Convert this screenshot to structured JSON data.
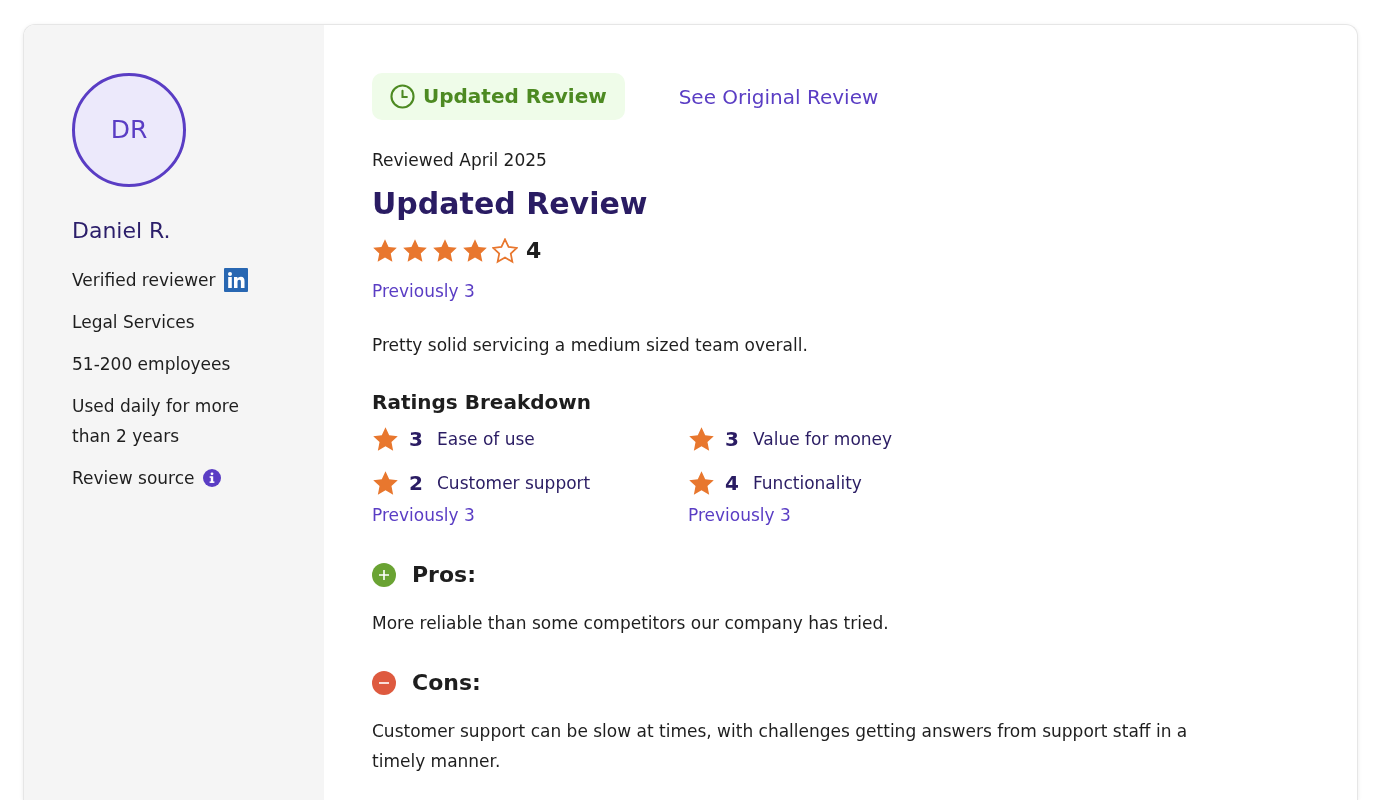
{
  "reviewer": {
    "initials": "DR",
    "name": "Daniel R.",
    "details": [
      {
        "text": "Verified reviewer",
        "kind": "linkedin"
      },
      {
        "text": "Legal Services",
        "kind": "plain"
      },
      {
        "text": "51-200 employees",
        "kind": "plain"
      },
      {
        "text": "Used daily for more than 2 years",
        "kind": "plain"
      },
      {
        "text": "Review source",
        "kind": "info"
      }
    ]
  },
  "review": {
    "badge": "Updated Review",
    "original_link": "See Original Review",
    "date": "Reviewed April 2025",
    "title": "Updated Review",
    "stars": 4,
    "rating": "4",
    "previous": "Previously 3",
    "summary": "Pretty solid servicing a medium sized team overall.",
    "breakdown": {
      "title": "Ratings Breakdown",
      "items": [
        {
          "score": "3",
          "label": "Ease of use"
        },
        {
          "score": "3",
          "label": "Value for money"
        },
        {
          "score": "2",
          "label": "Customer support",
          "previous": "Previously 3"
        },
        {
          "score": "4",
          "label": "Functionality",
          "previous": "Previously 3"
        }
      ]
    },
    "sections": [
      {
        "kind": "pros",
        "title": "Pros:",
        "text": "More reliable than some competitors our company has tried."
      },
      {
        "kind": "cons",
        "title": "Cons:",
        "text": "Customer support can be slow at times, with challenges getting answers from support staff in a timely manner."
      }
    ]
  }
}
